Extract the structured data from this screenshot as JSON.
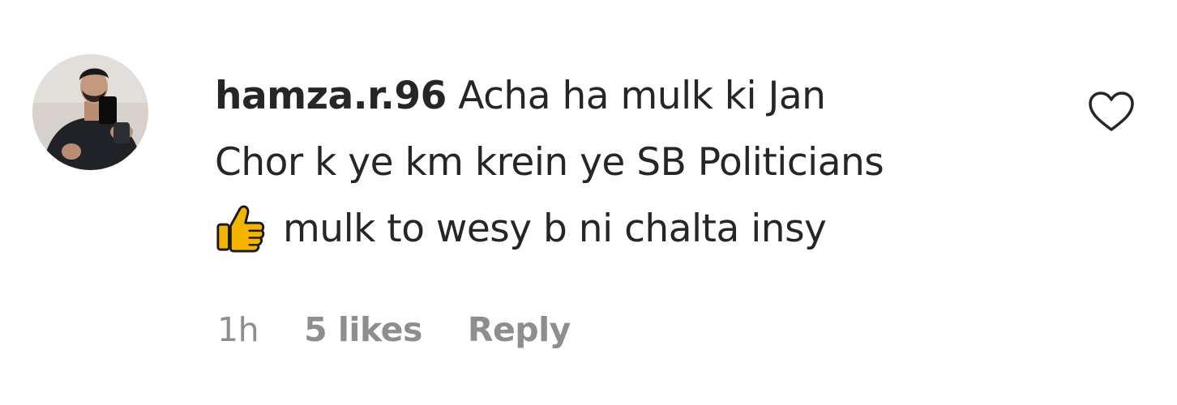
{
  "comment": {
    "username": "hamza.r.96",
    "lines": [
      "Acha ha mulk ki Jan",
      "Chor k ye km krein ye SB Politicians",
      "mulk to wesy b ni chalta insy"
    ],
    "emoji_icon": "thumbs-up-icon",
    "time": "1h",
    "likes": "5 likes",
    "reply_label": "Reply",
    "like_icon": "heart-outline-icon"
  },
  "colors": {
    "text": "#262626",
    "secondary": "#8e8e8e",
    "thumb": "#f5b400"
  }
}
